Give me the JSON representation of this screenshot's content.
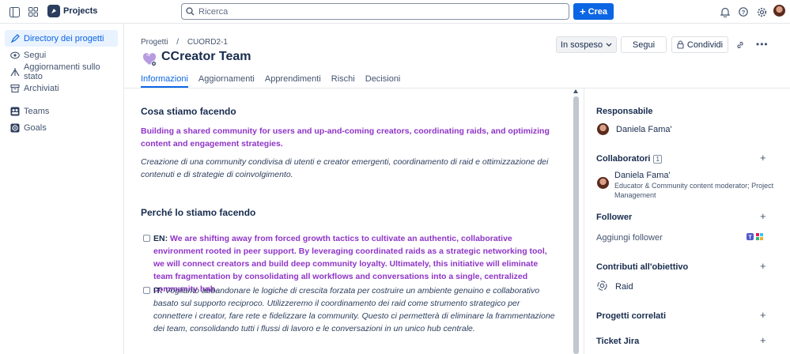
{
  "topbar": {
    "app_name": "Projects",
    "search_placeholder": "Ricerca",
    "create_label": "Crea"
  },
  "sidebar": {
    "items": [
      {
        "label": "Directory dei progetti",
        "icon": "rocket-icon"
      },
      {
        "label": "Segui",
        "icon": "eye-icon"
      },
      {
        "label": "Aggiornamenti sullo stato",
        "icon": "signal-icon"
      },
      {
        "label": "Archiviati",
        "icon": "archive-icon"
      },
      {
        "label": "Teams",
        "icon": "people-icon"
      },
      {
        "label": "Goals",
        "icon": "target-icon"
      }
    ]
  },
  "header": {
    "breadcrumb": [
      "Progetti",
      "/",
      "CUORD2-1"
    ],
    "title": "CCreator Team",
    "status_label": "In sospeso",
    "follow_label": "Segui",
    "share_label": "Condividi"
  },
  "tabs": [
    "Informazioni",
    "Aggiornamenti",
    "Apprendimenti",
    "Rischi",
    "Decisioni"
  ],
  "content": {
    "what_heading": "Cosa stiamo facendo",
    "what_en": "Building a shared community for users and up-and-coming creators, coordinating raids, and optimizing content and engagement strategies.",
    "what_it": "Creazione di una community condivisa di utenti e creator emergenti, coordinamento di raid e ottimizzazione dei contenuti e di strategie di coinvolgimento.",
    "why_heading": "Perché lo stiamo facendo",
    "why_en_label": "EN:",
    "why_en": "We are shifting away from forced growth tactics to cultivate an authentic, collaborative environment rooted in peer support. By leveraging coordinated raids as a strategic networking tool, we will connect creators and build deep community loyalty. Ultimately, this initiative will eliminate team fragmentation by consolidating all workflows and conversations into a single, centralized community hub.",
    "why_it_label": "IT:",
    "why_it": "Vogliamo abbandonare le logiche di crescita forzata per costruire un ambiente genuino e collaborativo basato sul supporto reciproco. Utilizzeremo il coordinamento dei raid come strumento strategico per connettere i creator, fare rete e fidelizzare la community. Questo ci permetterà di eliminare la frammentazione dei team, consolidando tutti i flussi di lavoro e le conversazioni in un unico hub centrale."
  },
  "right_panel": {
    "owner_heading": "Responsabile",
    "owner_name": "Daniela Fama'",
    "collab_heading": "Collaboratori",
    "collab_count": "1",
    "collab_name": "Daniela Fama'",
    "collab_role": "Educator & Community content moderator; Project Management",
    "follower_heading": "Follower",
    "add_follower": "Aggiungi follower",
    "contrib_heading": "Contributi all'obiettivo",
    "contrib_item": "Raid",
    "related_heading": "Progetti correlati",
    "jira_heading": "Ticket Jira"
  },
  "colors": {
    "accent": "#0c66e4",
    "purple_text": "#8f34c7"
  }
}
